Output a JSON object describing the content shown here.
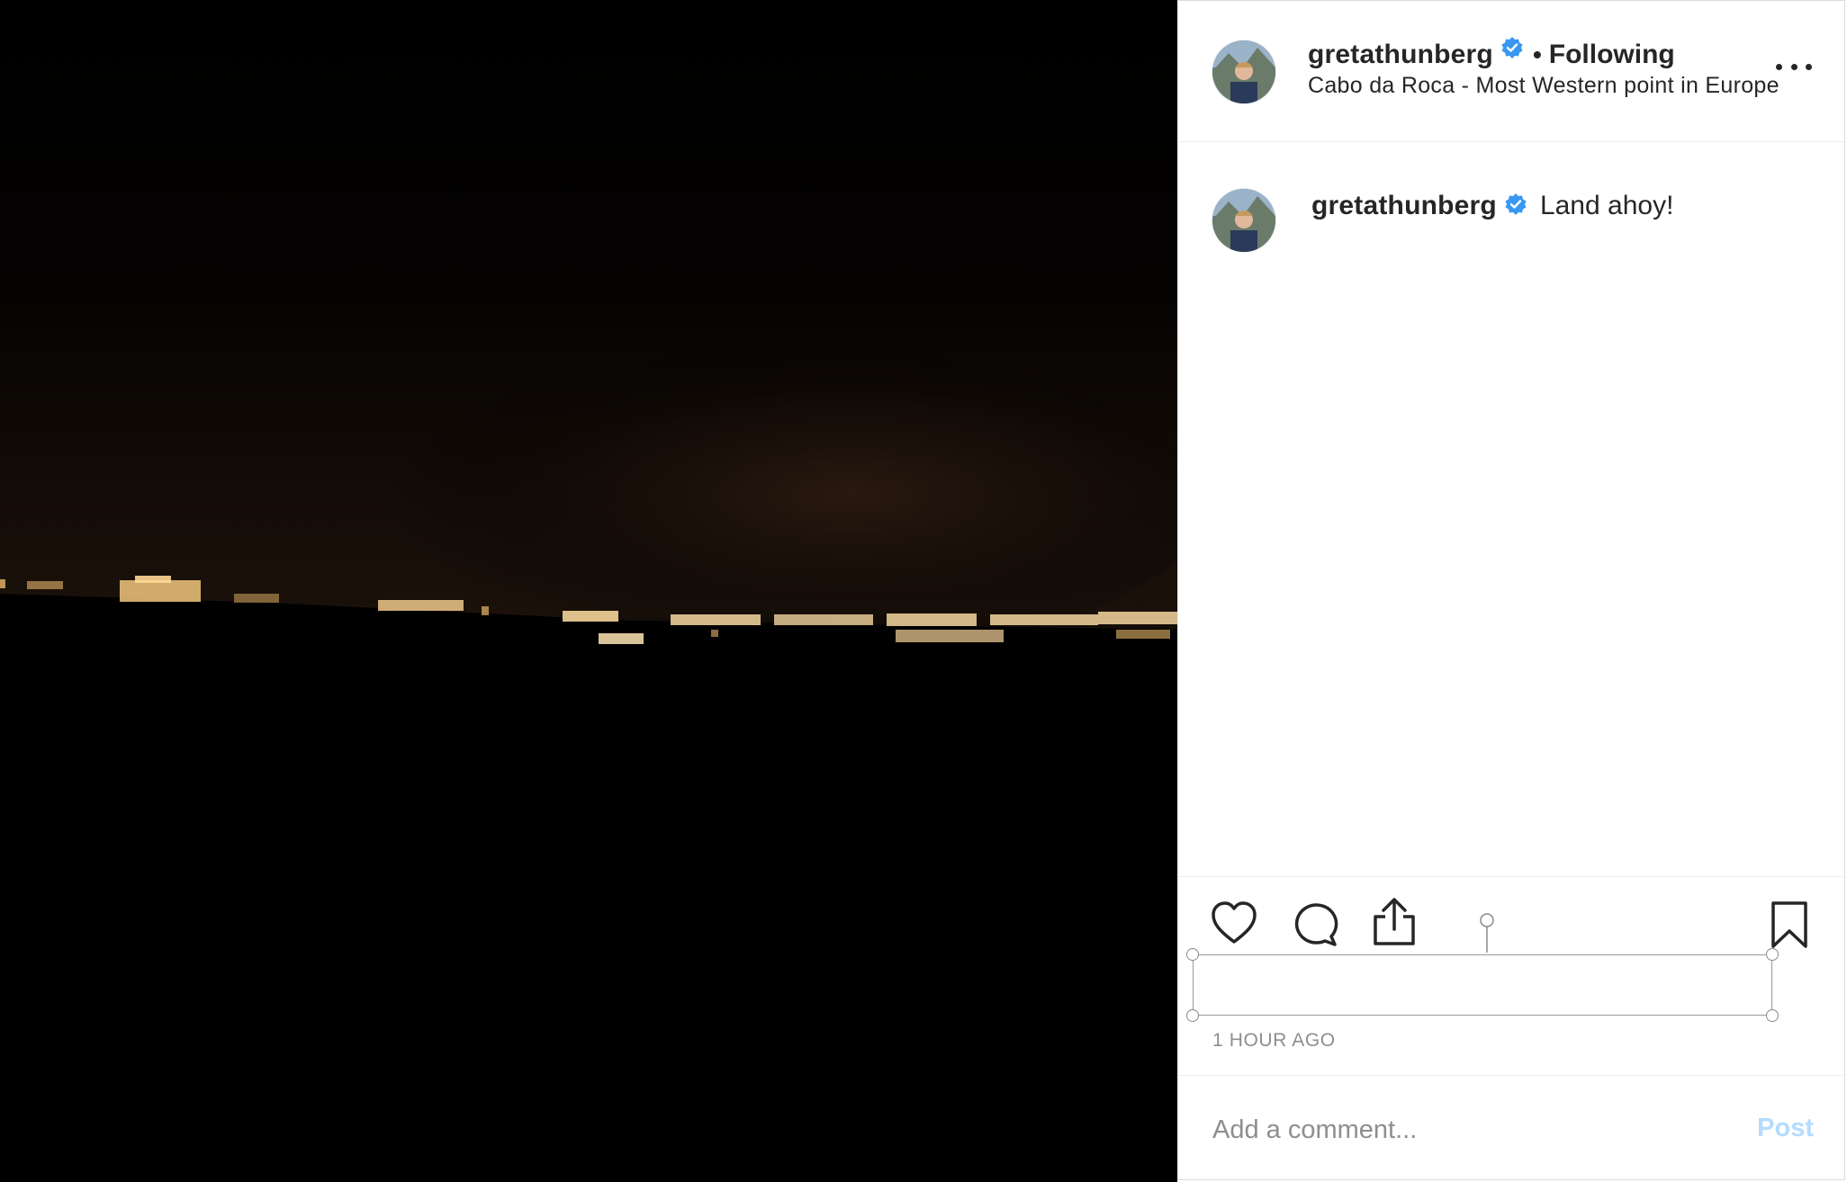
{
  "post": {
    "image_description": "",
    "author": {
      "username": "gretathunberg",
      "verified": true
    },
    "header": {
      "separator": "•",
      "follow_status": "Following",
      "location": "Cabo da Roca - Most Western point in Europe"
    },
    "caption": {
      "username": "gretathunberg",
      "text": "Land ahoy!"
    },
    "timestamp": "1 HOUR AGO",
    "comment": {
      "placeholder": "Add a comment...",
      "post_label": "Post"
    }
  },
  "colors": {
    "verified_badge": "#3897f0",
    "post_button_disabled": "#b3dbff",
    "muted_text": "#8e8e8e"
  },
  "icons": [
    "more-options-icon",
    "verified-badge-icon",
    "heart-icon",
    "comment-icon",
    "share-icon",
    "bookmark-icon"
  ]
}
